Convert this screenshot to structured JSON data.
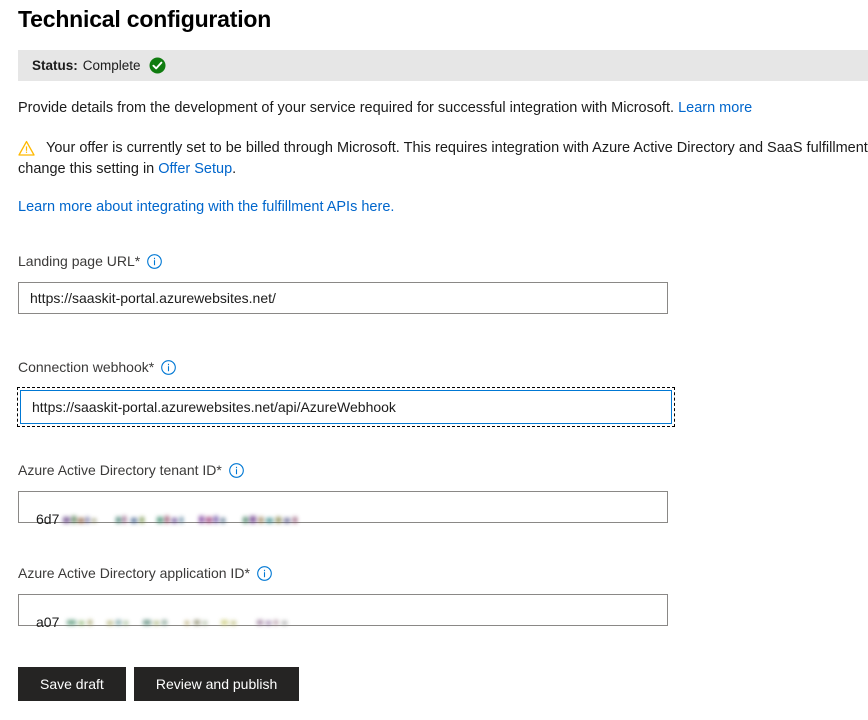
{
  "page_title": "Technical configuration",
  "status": {
    "label": "Status:",
    "value": "Complete",
    "icon": "check-circle-icon",
    "icon_color": "#107c10",
    "bar_color": "#e6e6e6"
  },
  "intro": {
    "text": "Provide details from the development of your service required for successful integration with Microsoft. ",
    "link_label": "Learn more"
  },
  "warning": {
    "icon": "warning-triangle-icon",
    "icon_color": "#ffb900",
    "text_part1": "Your offer is currently set to be billed through Microsoft. This requires integration with Azure Active Directory and SaaS fulfillment APIs",
    "text_part2": "change this setting in ",
    "link_label": "Offer Setup",
    "text_part3": "."
  },
  "fulfillment_link": {
    "label": "Learn more about integrating with the fulfillment APIs here."
  },
  "fields": [
    {
      "label": "Landing page URL",
      "required_marker": "*",
      "info_icon": "info-circle-icon",
      "value": "https://saaskit-portal.azurewebsites.net/",
      "placeholder": "",
      "focused": false,
      "redacted": false
    },
    {
      "label": "Connection webhook",
      "required_marker": "*",
      "info_icon": "info-circle-icon",
      "value": "https://saaskit-portal.azurewebsites.net/api/AzureWebhook",
      "placeholder": "",
      "focused": true,
      "redacted": false
    },
    {
      "label": "Azure Active Directory tenant ID",
      "required_marker": "*",
      "info_icon": "info-circle-icon",
      "value": "6d7",
      "placeholder": "",
      "focused": false,
      "redacted": true
    },
    {
      "label": "Azure Active Directory application ID",
      "required_marker": "*",
      "info_icon": "info-circle-icon",
      "value": "a07",
      "placeholder": "",
      "focused": false,
      "redacted": true
    }
  ],
  "buttons": {
    "save_draft": "Save draft",
    "review_publish": "Review and publish"
  },
  "colors": {
    "link": "#0066cc",
    "button_bg": "#252423",
    "focus_border": "#0078d4",
    "input_border": "#8a8886"
  }
}
